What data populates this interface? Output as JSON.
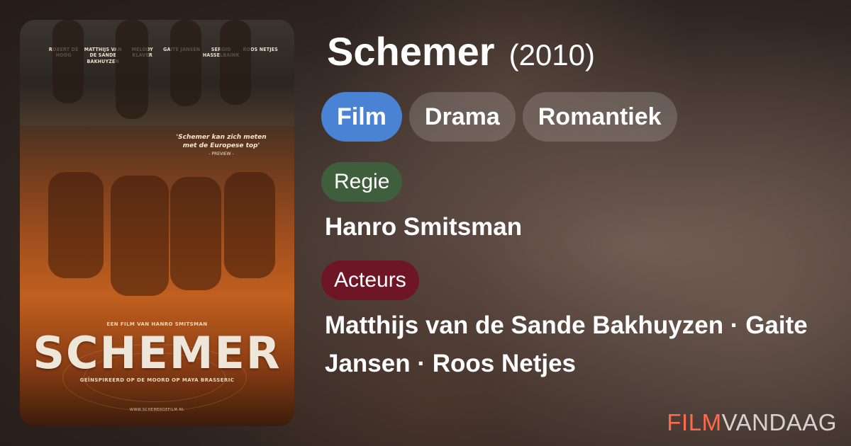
{
  "movie": {
    "title": "Schemer",
    "year": "(2010)"
  },
  "tags": [
    {
      "label": "Film"
    },
    {
      "label": "Drama"
    },
    {
      "label": "Romantiek"
    }
  ],
  "director": {
    "label": "Regie",
    "name": "Hanro Smitsman"
  },
  "cast": {
    "label": "Acteurs",
    "names": "Matthijs van de Sande Bakhuyzen · Gaite Jansen · Roos Netjes"
  },
  "brand": {
    "part_a": "FILM",
    "part_b": "VANDAAG"
  },
  "poster": {
    "cast": [
      "ROBERT DE HOOG",
      "MATTHIJS VAN DE SANDE BAKHUYZEN",
      "MELODY KLAVER",
      "GAITE JANSEN",
      "SERGIO HASSELBAINK",
      "ROOS NETJES"
    ],
    "quote": "'Schemer kan zich meten met de Europese top'",
    "quote_source": "- PREVIEW -",
    "film_by": "EEN FILM VAN HANRO SMITSMAN",
    "title": "SCHEMER",
    "subtitle": "GEÏNSPIREERD OP DE MOORD OP MAYA BRASSERIC",
    "url": "WWW.SCHEMERDEFILM.NL"
  },
  "colors": {
    "accent_film": "#4a82d4",
    "regie": "#3f5e3c",
    "acteurs": "#6e1626",
    "brand_red": "#ff6a4d"
  }
}
